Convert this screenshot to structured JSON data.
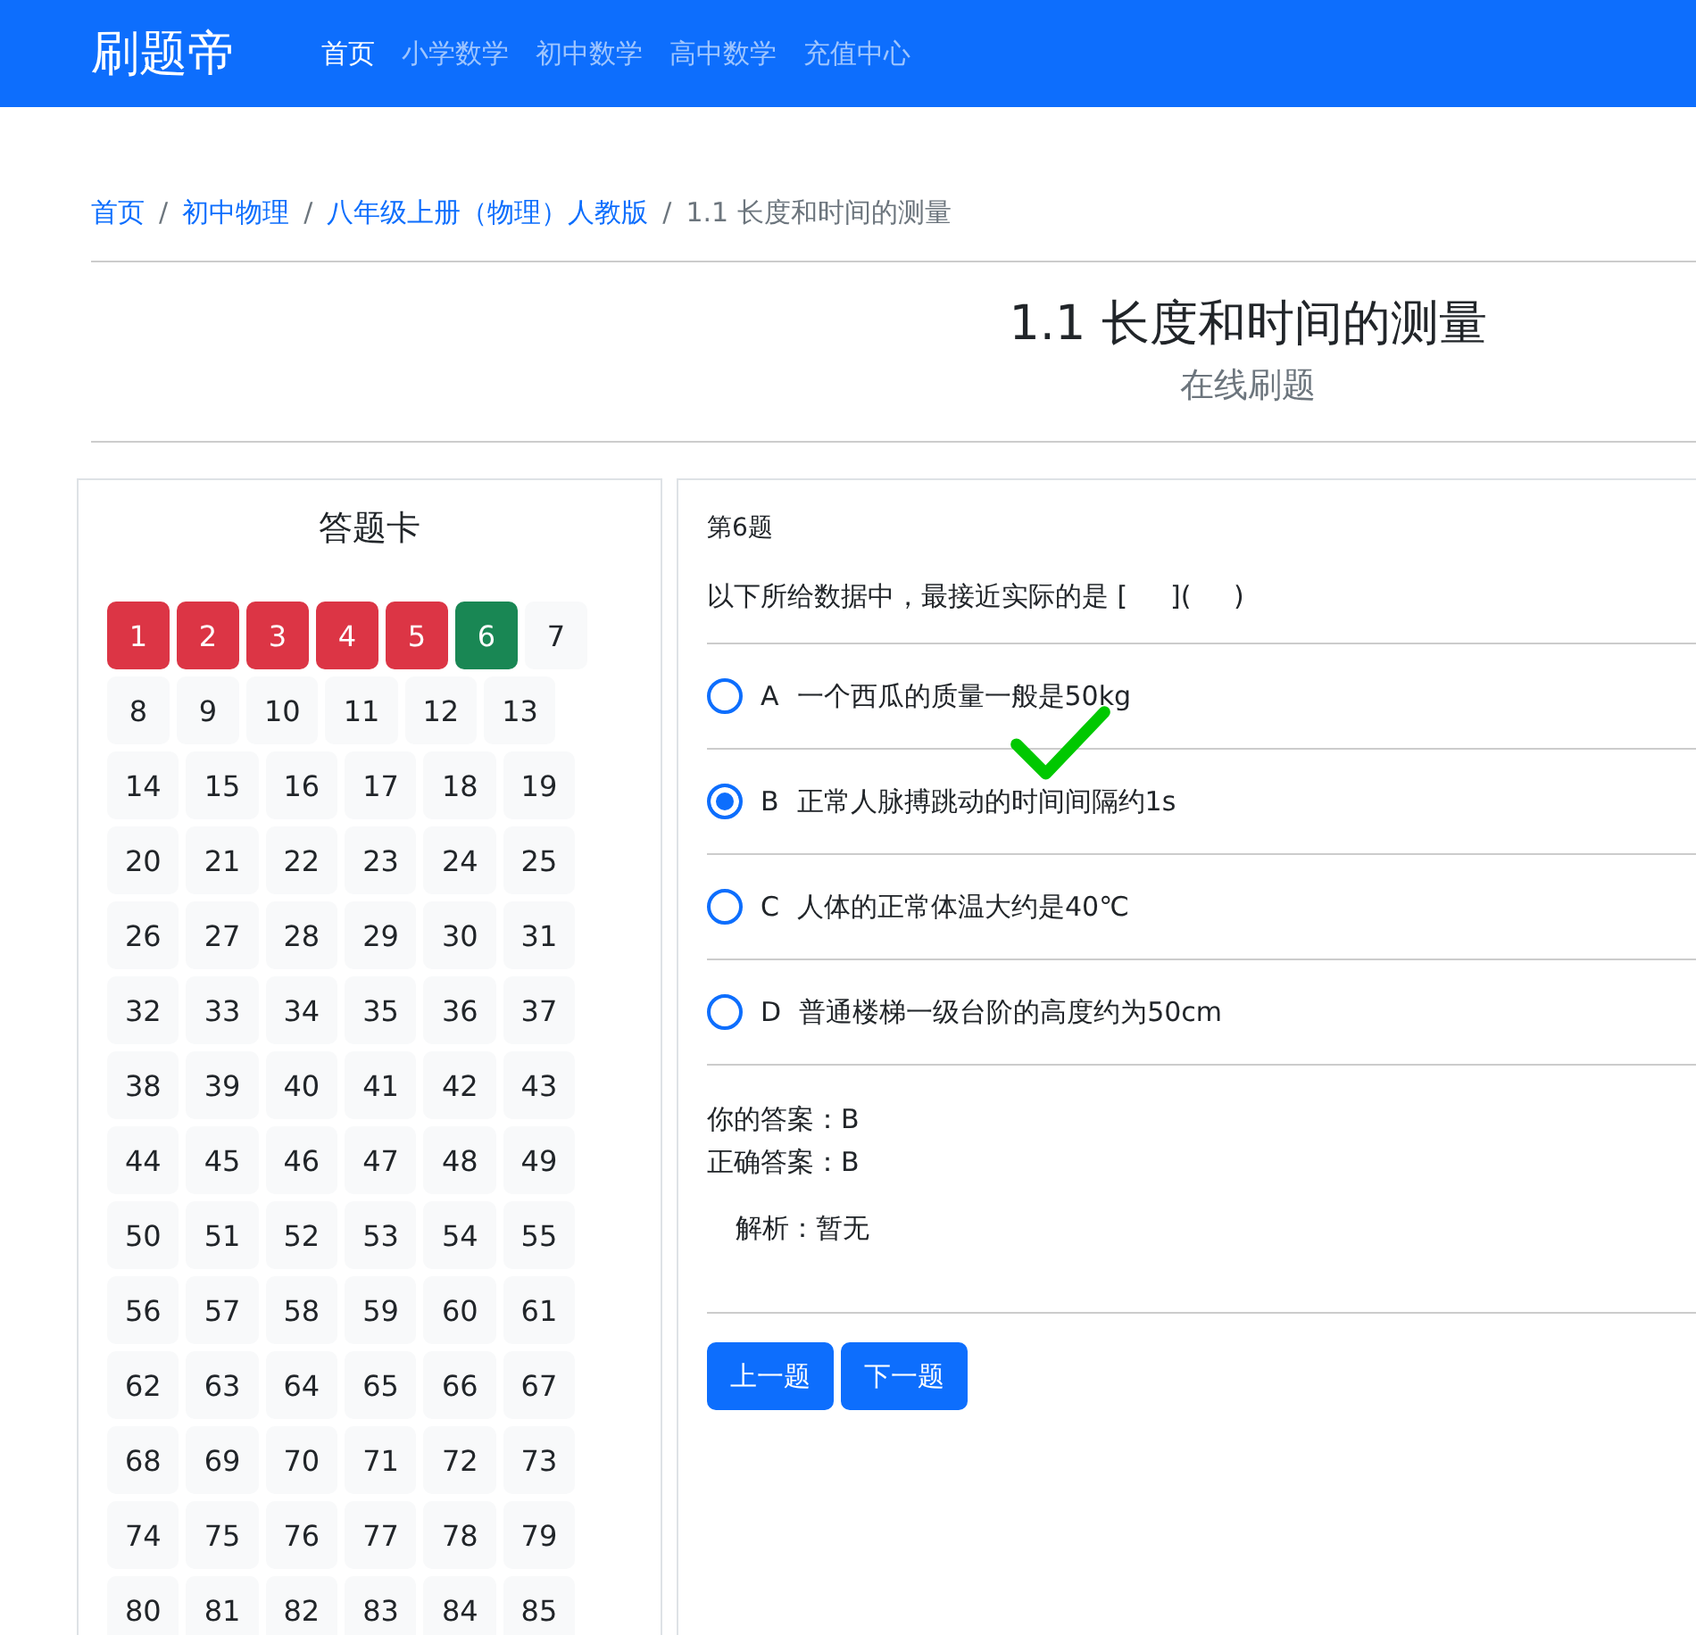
{
  "navbar": {
    "brand": "刷题帝",
    "items": [
      {
        "label": "首页",
        "selected": true
      },
      {
        "label": "小学数学",
        "selected": false
      },
      {
        "label": "初中数学",
        "selected": false
      },
      {
        "label": "高中数学",
        "selected": false
      },
      {
        "label": "充值中心",
        "selected": false
      }
    ]
  },
  "breadcrumb": [
    {
      "label": "首页",
      "link": true
    },
    {
      "label": "初中物理",
      "link": true
    },
    {
      "label": "八年级上册（物理）人教版",
      "link": true
    },
    {
      "label": "1.1 长度和时间的测量",
      "link": false
    }
  ],
  "breadcrumb_separator": "/",
  "page_title": "1.1 长度和时间的测量",
  "page_subtitle": "在线刷题",
  "answer_card": {
    "title": "答题卡",
    "items": [
      {
        "label": "1",
        "kind": "wrong"
      },
      {
        "label": "2",
        "kind": "wrong"
      },
      {
        "label": "3",
        "kind": "wrong"
      },
      {
        "label": "4",
        "kind": "wrong"
      },
      {
        "label": "5",
        "kind": "wrong"
      },
      {
        "label": "6",
        "kind": "right"
      },
      {
        "label": "7",
        "kind": "none"
      },
      {
        "label": "8",
        "kind": "none"
      },
      {
        "label": "9",
        "kind": "none"
      },
      {
        "label": "10",
        "kind": "none"
      },
      {
        "label": "11",
        "kind": "none"
      },
      {
        "label": "12",
        "kind": "none"
      },
      {
        "label": "13",
        "kind": "none"
      },
      {
        "label": "14",
        "kind": "none"
      },
      {
        "label": "15",
        "kind": "none"
      },
      {
        "label": "16",
        "kind": "none"
      },
      {
        "label": "17",
        "kind": "none"
      },
      {
        "label": "18",
        "kind": "none"
      },
      {
        "label": "19",
        "kind": "none"
      },
      {
        "label": "20",
        "kind": "none"
      },
      {
        "label": "21",
        "kind": "none"
      },
      {
        "label": "22",
        "kind": "none"
      },
      {
        "label": "23",
        "kind": "none"
      },
      {
        "label": "24",
        "kind": "none"
      },
      {
        "label": "25",
        "kind": "none"
      },
      {
        "label": "26",
        "kind": "none"
      },
      {
        "label": "27",
        "kind": "none"
      },
      {
        "label": "28",
        "kind": "none"
      },
      {
        "label": "29",
        "kind": "none"
      },
      {
        "label": "30",
        "kind": "none"
      },
      {
        "label": "31",
        "kind": "none"
      },
      {
        "label": "32",
        "kind": "none"
      },
      {
        "label": "33",
        "kind": "none"
      },
      {
        "label": "34",
        "kind": "none"
      },
      {
        "label": "35",
        "kind": "none"
      },
      {
        "label": "36",
        "kind": "none"
      },
      {
        "label": "37",
        "kind": "none"
      },
      {
        "label": "38",
        "kind": "none"
      },
      {
        "label": "39",
        "kind": "none"
      },
      {
        "label": "40",
        "kind": "none"
      },
      {
        "label": "41",
        "kind": "none"
      },
      {
        "label": "42",
        "kind": "none"
      },
      {
        "label": "43",
        "kind": "none"
      },
      {
        "label": "44",
        "kind": "none"
      },
      {
        "label": "45",
        "kind": "none"
      },
      {
        "label": "46",
        "kind": "none"
      },
      {
        "label": "47",
        "kind": "none"
      },
      {
        "label": "48",
        "kind": "none"
      },
      {
        "label": "49",
        "kind": "none"
      },
      {
        "label": "50",
        "kind": "none"
      },
      {
        "label": "51",
        "kind": "none"
      },
      {
        "label": "52",
        "kind": "none"
      },
      {
        "label": "53",
        "kind": "none"
      },
      {
        "label": "54",
        "kind": "none"
      },
      {
        "label": "55",
        "kind": "none"
      },
      {
        "label": "56",
        "kind": "none"
      },
      {
        "label": "57",
        "kind": "none"
      },
      {
        "label": "58",
        "kind": "none"
      },
      {
        "label": "59",
        "kind": "none"
      },
      {
        "label": "60",
        "kind": "none"
      },
      {
        "label": "61",
        "kind": "none"
      },
      {
        "label": "62",
        "kind": "none"
      },
      {
        "label": "63",
        "kind": "none"
      },
      {
        "label": "64",
        "kind": "none"
      },
      {
        "label": "65",
        "kind": "none"
      },
      {
        "label": "66",
        "kind": "none"
      },
      {
        "label": "67",
        "kind": "none"
      },
      {
        "label": "68",
        "kind": "none"
      },
      {
        "label": "69",
        "kind": "none"
      },
      {
        "label": "70",
        "kind": "none"
      },
      {
        "label": "71",
        "kind": "none"
      },
      {
        "label": "72",
        "kind": "none"
      },
      {
        "label": "73",
        "kind": "none"
      },
      {
        "label": "74",
        "kind": "none"
      },
      {
        "label": "75",
        "kind": "none"
      },
      {
        "label": "76",
        "kind": "none"
      },
      {
        "label": "77",
        "kind": "none"
      },
      {
        "label": "78",
        "kind": "none"
      },
      {
        "label": "79",
        "kind": "none"
      },
      {
        "label": "80",
        "kind": "none"
      },
      {
        "label": "81",
        "kind": "none"
      },
      {
        "label": "82",
        "kind": "none"
      },
      {
        "label": "83",
        "kind": "none"
      },
      {
        "label": "84",
        "kind": "none"
      },
      {
        "label": "85",
        "kind": "none"
      }
    ]
  },
  "question": {
    "number": "第6题",
    "text": "以下所给数据中，最接近实际的是 [     ](     )",
    "options": [
      {
        "letter": "A",
        "text": "一个西瓜的质量一般是50kg",
        "selected": false,
        "checkmark": false
      },
      {
        "letter": "B",
        "text": "正常人脉搏跳动的时间间隔约1s",
        "selected": true,
        "checkmark": true
      },
      {
        "letter": "C",
        "text": "人体的正常体温大约是40℃",
        "selected": false,
        "checkmark": false
      },
      {
        "letter": "D",
        "text": "普通楼梯一级台阶的高度约为50cm",
        "selected": false,
        "checkmark": false
      }
    ],
    "your_answer": "你的答案：B",
    "correct_answer": "正确答案：B",
    "analysis": "解析：暂无",
    "buttons": [
      "上一题",
      "下一题"
    ]
  }
}
